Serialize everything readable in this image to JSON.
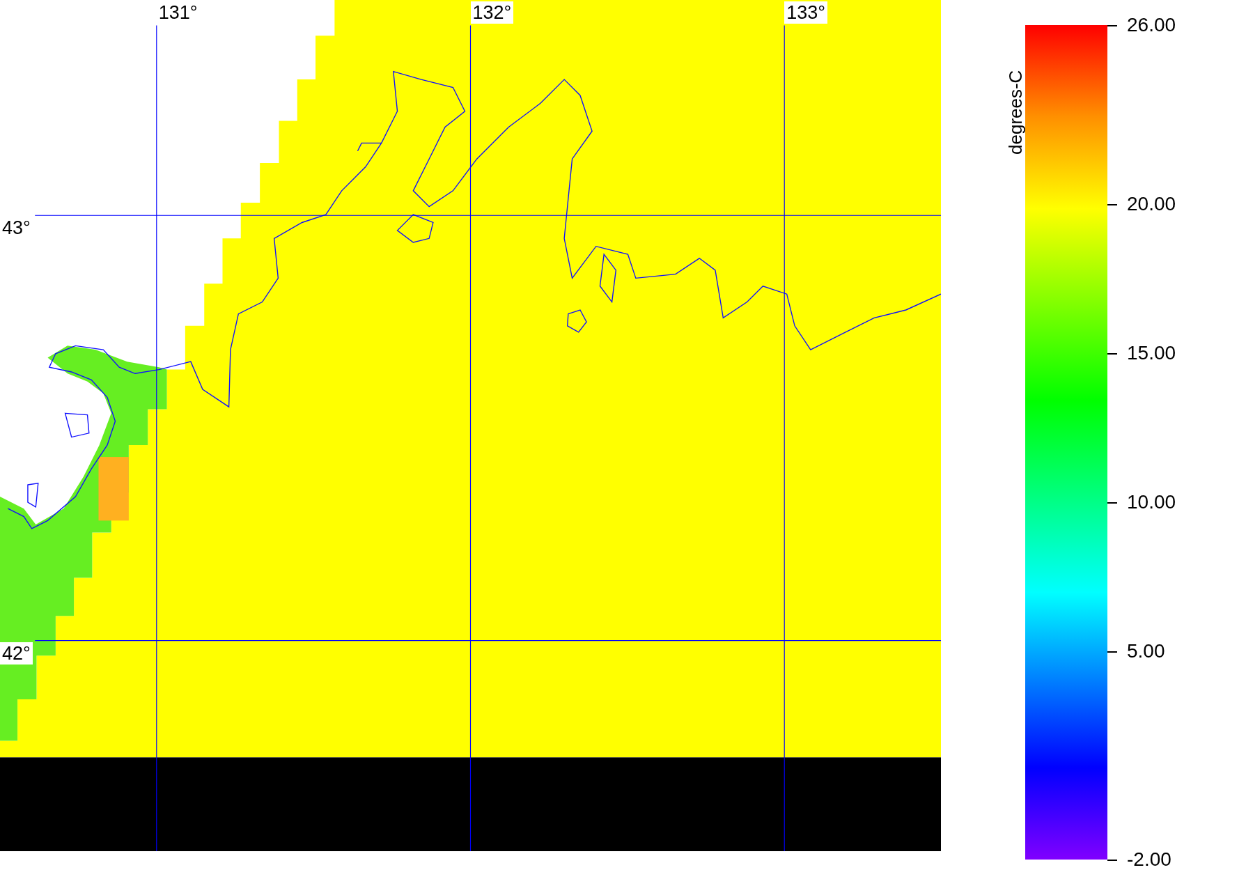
{
  "map": {
    "lon_labels": [
      "131°",
      "132°",
      "133°"
    ],
    "lat_labels": [
      "43°",
      "42°"
    ]
  },
  "colorbar": {
    "title": "degrees-C",
    "ticks": [
      "26.00",
      "20.00",
      "15.00",
      "10.00",
      "5.00",
      "-2.00"
    ]
  }
}
